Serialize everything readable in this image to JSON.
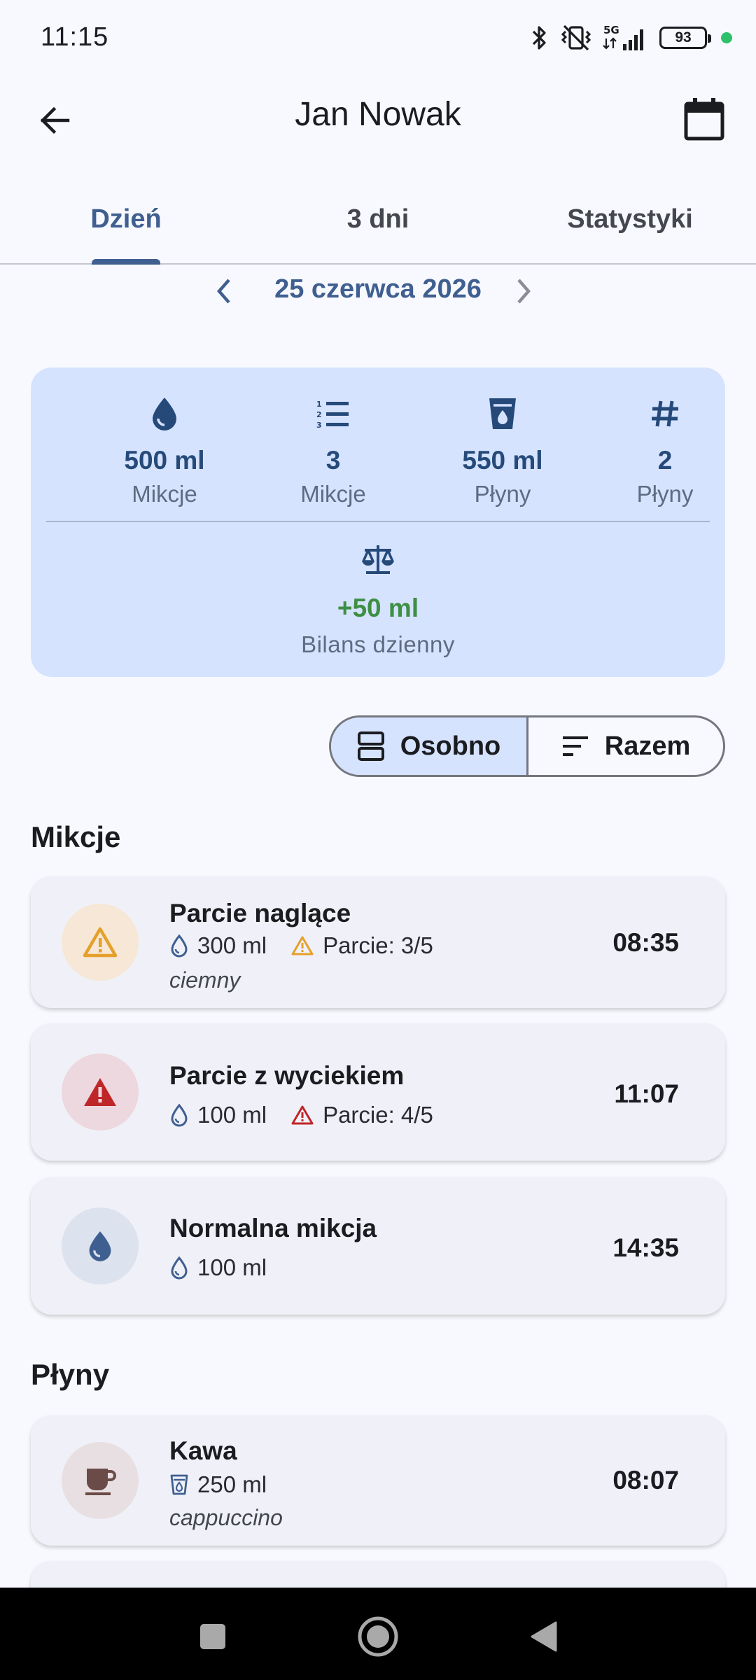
{
  "status_bar": {
    "time": "11:15",
    "network": "5G",
    "battery": "93",
    "icons": [
      "bluetooth-icon",
      "vibrate-off-icon",
      "signal-5g-icon",
      "battery-icon",
      "privacy-dot-icon"
    ]
  },
  "app_bar": {
    "title": "Jan Nowak",
    "back_icon": "arrow-left-icon",
    "calendar_icon": "calendar-icon"
  },
  "tabs": [
    {
      "label": "Dzień",
      "active": true
    },
    {
      "label": "3 dni",
      "active": false
    },
    {
      "label": "Statystyki",
      "active": false
    }
  ],
  "date_nav": {
    "label": "25 czerwca 2026"
  },
  "summary": {
    "stats": [
      {
        "icon": "droplet-icon",
        "value": "500 ml",
        "label": "Mikcje"
      },
      {
        "icon": "numbered-list-icon",
        "value": "3",
        "label": "Mikcje"
      },
      {
        "icon": "cup-icon",
        "value": "550 ml",
        "label": "Płyny"
      },
      {
        "icon": "hash-icon",
        "value": "2",
        "label": "Płyny"
      }
    ],
    "balance": {
      "icon": "scale-icon",
      "value": "+50 ml",
      "label": "Bilans dzienny"
    }
  },
  "view_toggle": {
    "options": [
      {
        "label": "Osobno",
        "selected": true,
        "icon": "split-view-icon"
      },
      {
        "label": "Razem",
        "selected": false,
        "icon": "sort-lines-icon"
      }
    ]
  },
  "sections": {
    "voids_title": "Mikcje",
    "fluids_title": "Płyny"
  },
  "voids": [
    {
      "title": "Parcie naglące",
      "volume": "300 ml",
      "urgency": "Parcie: 3/5",
      "note": "ciemny",
      "time": "08:35",
      "icon": "warning-icon",
      "accent": "#e5a02b",
      "avatar_bg": "#f6e7d6"
    },
    {
      "title": "Parcie z wyciekiem",
      "volume": "100 ml",
      "urgency": "Parcie: 4/5",
      "time": "11:07",
      "icon": "alert-filled-icon",
      "accent": "#bf2628",
      "avatar_bg": "#ecd8de"
    },
    {
      "title": "Normalna mikcja",
      "volume": "100 ml",
      "time": "14:35",
      "icon": "droplet-icon",
      "accent": "#3f5f90",
      "avatar_bg": "#dce2ee"
    }
  ],
  "fluids": [
    {
      "title": "Kawa",
      "volume": "250 ml",
      "note": "cappuccino",
      "time": "08:07",
      "icon": "coffee-cup-icon",
      "accent": "#6b4b48",
      "avatar_bg": "#e8dfe2"
    }
  ],
  "colors": {
    "primary": "#3f5f90",
    "summary_bg": "#d6e3ff",
    "balance_positive": "#3d8f44",
    "background": "#f8f9fe"
  }
}
